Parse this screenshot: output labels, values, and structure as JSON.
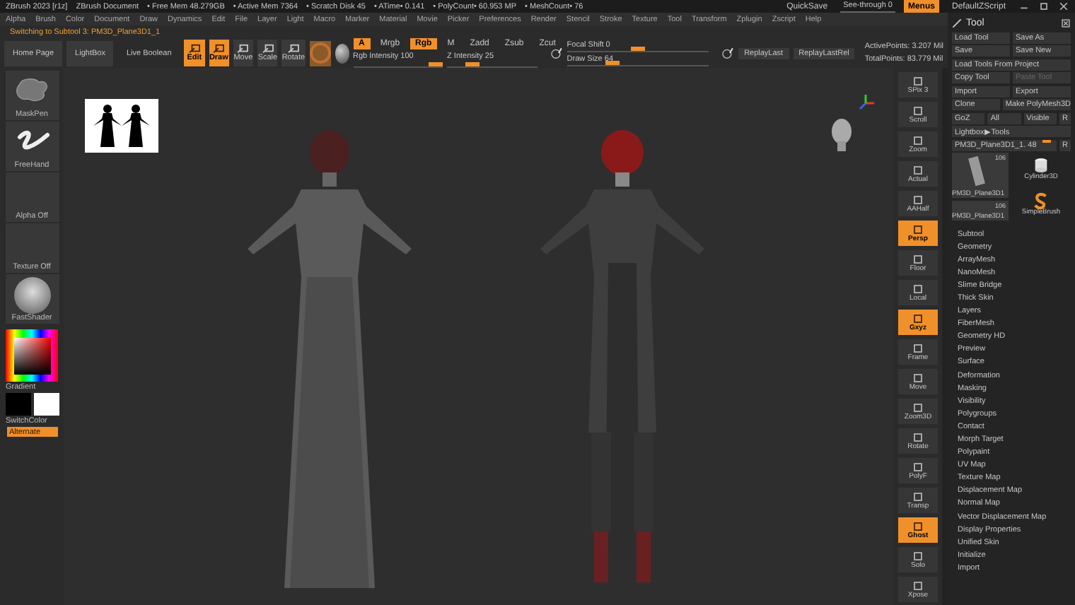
{
  "title_bar": {
    "items": [
      "ZBrush 2023 [r1z]",
      "ZBrush Document",
      "• Free Mem 48.279GB",
      "• Active Mem 7364",
      "• Scratch Disk 45",
      "• ATime• 0.141",
      "• PolyCount• 60.953 MP",
      "• MeshCount• 76"
    ],
    "quicksave": "QuickSave",
    "see_through": {
      "label": "See-through 0",
      "level": 0
    },
    "menus": {
      "label": "Menus",
      "on": true
    },
    "script": "DefaultZScript"
  },
  "menu_bar": [
    "Alpha",
    "Brush",
    "Color",
    "Document",
    "Draw",
    "Dynamics",
    "Edit",
    "File",
    "Layer",
    "Light",
    "Macro",
    "Marker",
    "Material",
    "Movie",
    "Picker",
    "Preferences",
    "Render",
    "Stencil",
    "Stroke",
    "Texture",
    "Tool",
    "Transform",
    "Zplugin",
    "Zscript",
    "Help"
  ],
  "status": "Switching to Subtool 3: PM3D_Plane3D1_1",
  "toolbar": {
    "buttons": [
      "Home Page",
      "LightBox",
      "Live Boolean"
    ],
    "modes": [
      {
        "label": "Edit",
        "selected": true
      },
      {
        "label": "Draw",
        "selected": true
      },
      {
        "label": "Move",
        "selected": false
      },
      {
        "label": "Scale",
        "selected": false
      },
      {
        "label": "Rotate",
        "selected": false
      }
    ],
    "channels": [
      {
        "label": "A",
        "selected": true
      },
      {
        "label": "Mrgb",
        "selected": false
      },
      {
        "label": "Rgb",
        "selected": true
      },
      {
        "label": "M",
        "selected": false
      }
    ],
    "z_modes": [
      {
        "label": "Zadd",
        "selected": false
      },
      {
        "label": "Zsub",
        "selected": false
      },
      {
        "label": "Zcut",
        "selected": false
      }
    ],
    "sliders_a": [
      {
        "label": "Rgb Intensity 100",
        "level": 1
      },
      {
        "label": "Z Intensity 25",
        "level": 0.25
      }
    ],
    "sliders_b": [
      {
        "label": "Focal Shift 0",
        "level": 0.5
      },
      {
        "label": "Draw Size 64",
        "level": 0.3
      }
    ],
    "replay": [
      "ReplayLast",
      "ReplayLastRel"
    ],
    "points": [
      "ActivePoints: 3.207 Mil",
      "TotalPoints: 83.779 Mil"
    ]
  },
  "shelf": [
    {
      "label": "MaskPen",
      "kind": "blob"
    },
    {
      "label": "FreeHand",
      "kind": "stroke"
    },
    {
      "label": "Alpha Off",
      "kind": "empty"
    },
    {
      "label": "Texture Off",
      "kind": "empty"
    },
    {
      "label": "FastShader",
      "kind": "sphere"
    }
  ],
  "color": {
    "gradient": "Gradient",
    "switch": "SwitchColor",
    "alternate": "Alternate"
  },
  "strip": [
    {
      "label": "SPix 3",
      "selected": false
    },
    {
      "label": "Scroll",
      "selected": false
    },
    {
      "label": "Zoom",
      "selected": false
    },
    {
      "label": "Actual",
      "selected": false
    },
    {
      "label": "AAHalf",
      "selected": false
    },
    {
      "label": "Persp",
      "selected": true
    },
    {
      "label": "Floor",
      "selected": false
    },
    {
      "label": "Local",
      "selected": false
    },
    {
      "label": "Gxyz",
      "selected": true
    },
    {
      "label": "Frame",
      "selected": false
    },
    {
      "label": "Move",
      "selected": false
    },
    {
      "label": "Zoom3D",
      "selected": false
    },
    {
      "label": "Rotate",
      "selected": false
    },
    {
      "label": "PolyF",
      "selected": false
    },
    {
      "label": "Transp",
      "selected": false
    },
    {
      "label": "Ghost",
      "selected": true
    },
    {
      "label": "Solo",
      "selected": false
    },
    {
      "label": "Xpose",
      "selected": false
    }
  ],
  "tool": {
    "title": "Tool",
    "rows": [
      [
        {
          "label": "Load Tool",
          "disabled": false
        },
        {
          "label": "Save As",
          "disabled": false
        }
      ],
      [
        {
          "label": "Save",
          "disabled": false
        },
        {
          "label": "Save New",
          "disabled": false
        }
      ],
      [
        {
          "label": "Load Tools From Project",
          "disabled": false
        }
      ],
      [
        {
          "label": "Copy Tool",
          "disabled": false
        },
        {
          "label": "Paste Tool",
          "disabled": true
        }
      ],
      [
        {
          "label": "Import",
          "disabled": false
        },
        {
          "label": "Export",
          "disabled": false
        }
      ],
      [
        {
          "label": "Clone",
          "disabled": false
        },
        {
          "label": "Make PolyMesh3D",
          "disabled": false
        }
      ],
      [
        {
          "label": "GoZ",
          "disabled": false
        },
        {
          "label": "All",
          "disabled": false
        },
        {
          "label": "Visible",
          "disabled": false
        },
        {
          "label": "R",
          "disabled": false
        }
      ],
      [
        {
          "label": "Lightbox▶Tools",
          "disabled": false
        }
      ]
    ],
    "slider": {
      "label": "PM3D_Plane3D1_1. 48",
      "level": 0.95,
      "r": "R"
    },
    "thumbs": [
      {
        "label": "PM3D_Plane3D1",
        "count": "106"
      },
      {
        "label": "Cylinder3D"
      },
      {
        "label": "SimpleBrush"
      },
      {
        "label": "PM3D_Plane3D1",
        "count": "106"
      }
    ],
    "sections": [
      "Subtool",
      "Geometry",
      "ArrayMesh",
      "NanoMesh",
      "Slime Bridge",
      "Thick Skin",
      "Layers",
      "FiberMesh",
      "Geometry HD",
      "Preview",
      "Surface",
      "Deformation",
      "Masking",
      "Visibility",
      "Polygroups",
      "Contact",
      "Morph Target",
      "Polypaint",
      "UV Map",
      "Texture Map",
      "Displacement Map",
      "Normal Map",
      "Vector Displacement Map",
      "Display Properties",
      "Unified Skin",
      "Initialize",
      "Import"
    ]
  }
}
